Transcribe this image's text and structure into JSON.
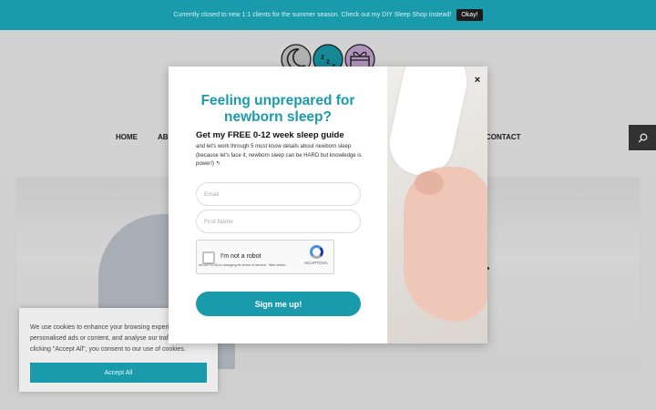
{
  "announcement": {
    "text": "Currently closed to new 1:1 clients for the summer season. Check out my DIY Sleep Shop instead!",
    "button": "Okay!"
  },
  "nav": {
    "home": "HOME",
    "about": "ABO",
    "contact": "CONTACT"
  },
  "modal": {
    "close": "×",
    "title": "Feeling unprepared for newborn sleep?",
    "subtitle": "Get my FREE 0-12 week sleep guide",
    "description": "and let's work through 5 must know details about newborn sleep (because let's face it, newborn sleep can be HARD but knowledge is power!) ↰",
    "email_placeholder": "Email",
    "name_placeholder": "First Name",
    "captcha_label": "I'm not a robot",
    "captcha_brand": "reCAPTCHA",
    "captcha_note": "reCAPTCHA is changing its terms of service. Take action.",
    "submit": "Sign me up!"
  },
  "cookie": {
    "text": "We use cookies to enhance your browsing experience, serve personalised ads or content, and analyse our traffic. By clicking \"Accept All\", you consent to our use of cookies.",
    "button": "Accept All"
  },
  "colors": {
    "accent": "#1a9bab",
    "logo_gray": "#c9c9c9",
    "logo_teal": "#1a9bab",
    "logo_purple": "#c9a8d8"
  },
  "icons": [
    "moon-icon",
    "zzz-icon",
    "gift-icon",
    "search-icon",
    "close-icon"
  ]
}
